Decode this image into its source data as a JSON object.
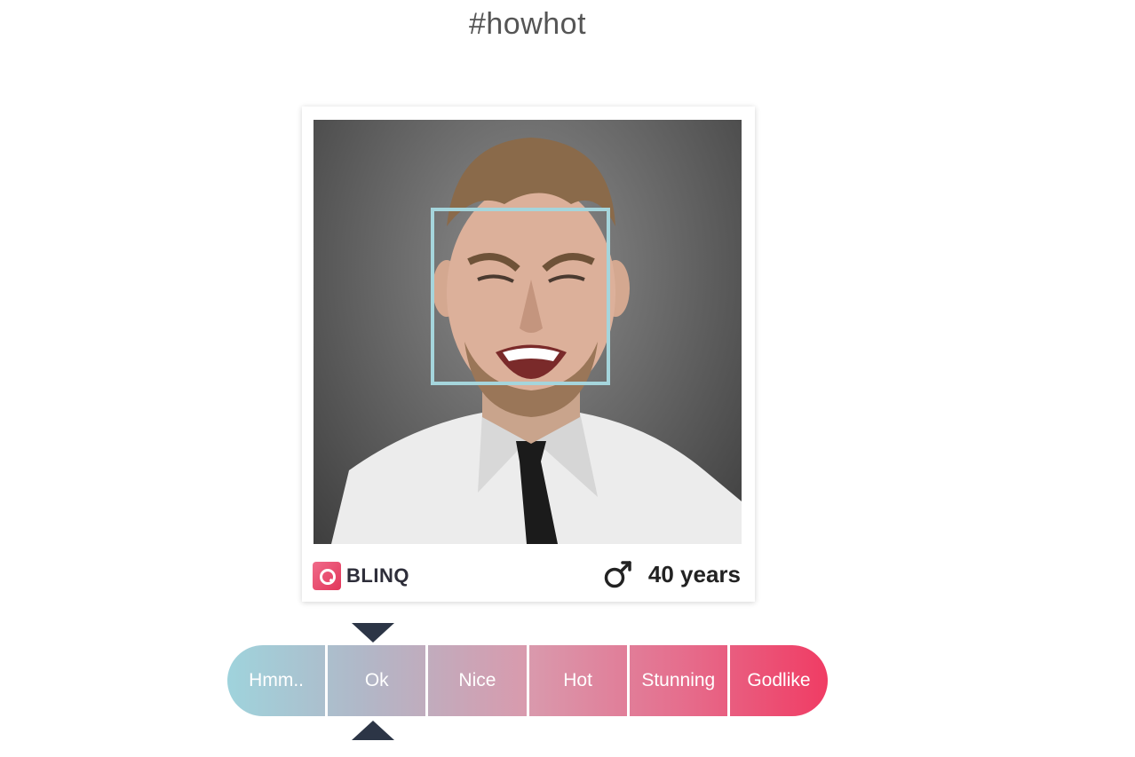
{
  "hashtag": "#howhot",
  "card": {
    "brand": "BLINQ",
    "gender_icon": "male-icon",
    "age": "40 years"
  },
  "rating": {
    "levels": [
      "Hmm..",
      "Ok",
      "Nice",
      "Hot",
      "Stunning",
      "Godlike"
    ],
    "selected": "Ok"
  },
  "colors": {
    "face_box": "#a5d5dc",
    "scale_start": "#9fd3dc",
    "scale_end": "#f03c64",
    "marker": "#2c3546"
  }
}
